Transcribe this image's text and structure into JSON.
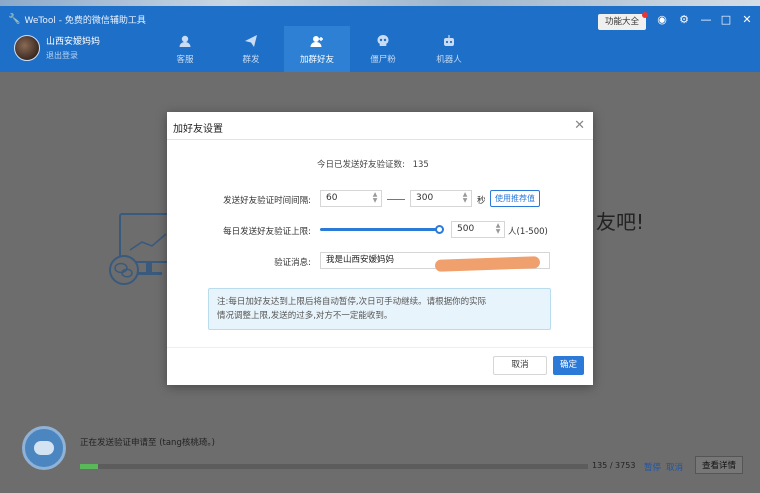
{
  "window": {
    "title": "WeTool - 免费的微信辅助工具",
    "functions_button": "功能大全"
  },
  "profile": {
    "name": "山西安嫒妈妈",
    "logout": "退出登录"
  },
  "nav": {
    "items": [
      {
        "label": "客服",
        "icon": "customer-service-icon"
      },
      {
        "label": "群发",
        "icon": "send-icon"
      },
      {
        "label": "加群好友",
        "icon": "add-friend-icon"
      },
      {
        "label": "僵尸粉",
        "icon": "skull-icon"
      },
      {
        "label": "机器人",
        "icon": "robot-icon"
      }
    ],
    "active_index": 2
  },
  "background": {
    "partial_text": "友吧!"
  },
  "modal": {
    "title": "加好友设置",
    "today_sent_label": "今日已发送好友验证数:",
    "today_sent_value": "135",
    "interval_label": "发送好友验证时间间隔:",
    "interval_min": "60",
    "interval_max": "300",
    "interval_unit": "秒",
    "recommend_button": "使用推荐值",
    "daily_limit_label": "每日发送好友验证上限:",
    "daily_limit_value": "500",
    "daily_limit_unit": "人(1-500)",
    "message_label": "验证消息:",
    "message_value": "我是山西安嫒妈妈",
    "note_line1": "注:每日加好友达到上限后将自动暂停,次日可手动继续。请根据你的实际",
    "note_line2": "情况调整上限,发送的过多,对方不一定能收到。",
    "cancel_button": "取消",
    "ok_button": "确定"
  },
  "status": {
    "text": "正在发送验证申请至 (tang核桃琦。)",
    "progress_current": 135,
    "progress_total": 3753,
    "count_text": "135 / 3753",
    "pause_link": "暂停",
    "cancel_link": "取消",
    "detail_button": "查看详情"
  },
  "colors": {
    "brand_blue": "#1e6fc7",
    "accent_blue": "#2b7ad8",
    "progress_green": "#5ab85a",
    "redaction_orange": "#f0a06d"
  }
}
